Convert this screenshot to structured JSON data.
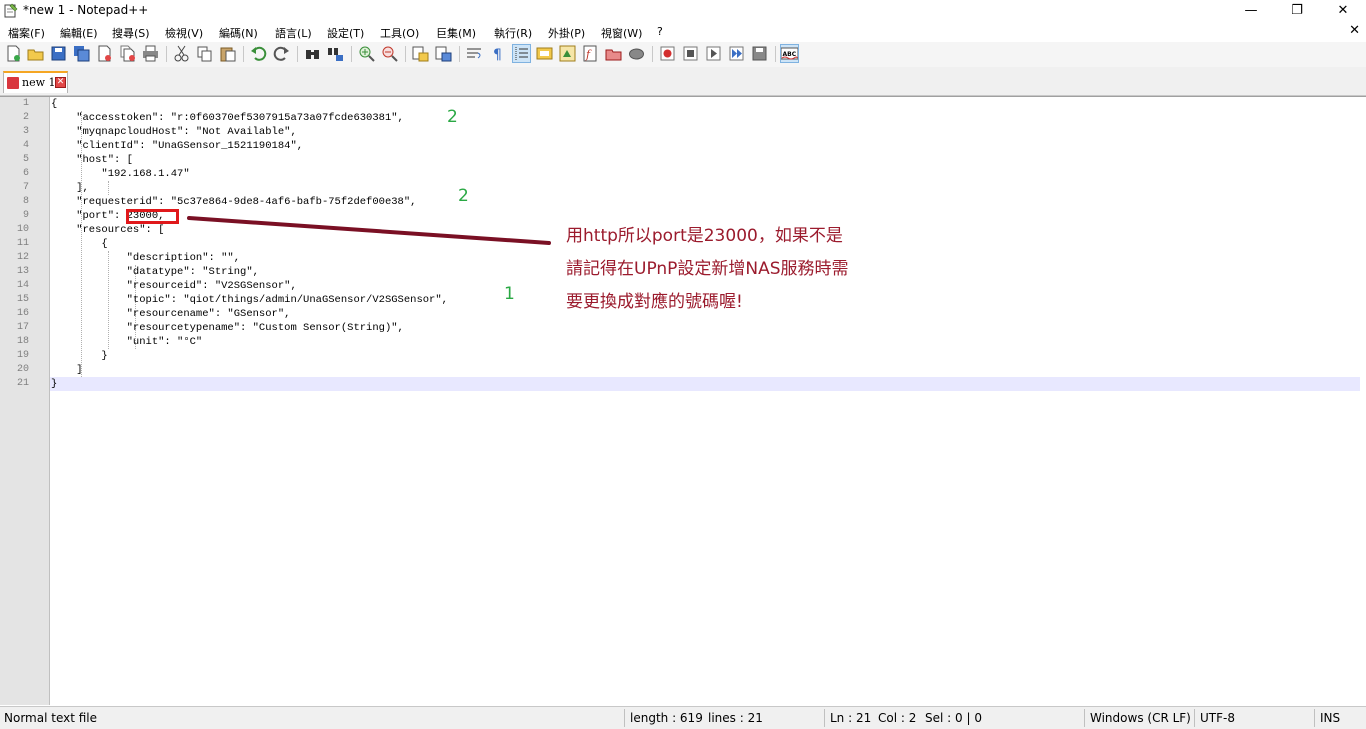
{
  "window": {
    "title": "*new 1 - Notepad++"
  },
  "menu": [
    "檔案(F)",
    "編輯(E)",
    "搜尋(S)",
    "檢視(V)",
    "編碼(N)",
    "語言(L)",
    "設定(T)",
    "工具(O)",
    "巨集(M)",
    "執行(R)",
    "外掛(P)",
    "視窗(W)",
    "?"
  ],
  "tab": {
    "label": "new 1",
    "close": "✕"
  },
  "lines": [
    {
      "n": "1",
      "t": "{"
    },
    {
      "n": "2",
      "t": "    \"accesstoken\": \"r:0f60370ef5307915a73a07fcde630381\","
    },
    {
      "n": "3",
      "t": "    \"myqnapcloudHost\": \"Not Available\","
    },
    {
      "n": "4",
      "t": "    \"clientId\": \"UnaGSensor_1521190184\","
    },
    {
      "n": "5",
      "t": "    \"host\": ["
    },
    {
      "n": "6",
      "t": "        \"192.168.1.47\""
    },
    {
      "n": "7",
      "t": "    ],"
    },
    {
      "n": "8",
      "t": "    \"requesterid\": \"5c37e864-9de8-4af6-bafb-75f2def00e38\","
    },
    {
      "n": "9",
      "t": "    \"port\": 23000,"
    },
    {
      "n": "10",
      "t": "    \"resources\": ["
    },
    {
      "n": "11",
      "t": "        {"
    },
    {
      "n": "12",
      "t": "            \"description\": \"\","
    },
    {
      "n": "13",
      "t": "            \"datatype\": \"String\","
    },
    {
      "n": "14",
      "t": "            \"resourceid\": \"V2SGSensor\","
    },
    {
      "n": "15",
      "t": "            \"topic\": \"qiot/things/admin/UnaGSensor/V2SGSensor\","
    },
    {
      "n": "16",
      "t": "            \"resourcename\": \"GSensor\","
    },
    {
      "n": "17",
      "t": "            \"resourcetypename\": \"Custom Sensor(String)\","
    },
    {
      "n": "18",
      "t": "            \"unit\": \"°C\""
    },
    {
      "n": "19",
      "t": "        }"
    },
    {
      "n": "20",
      "t": "    ]"
    },
    {
      "n": "21",
      "t": "}"
    }
  ],
  "annotations": {
    "mark_line2": "2",
    "mark_line8": "2",
    "mark_line15": "1"
  },
  "note_lines": [
    "用http所以port是23000，如果不是",
    "請記得在UPnP設定新增NAS服務時需",
    "要更換成對應的號碼喔!"
  ],
  "status": {
    "type": "Normal text file",
    "length": "length : 619",
    "lines": "lines : 21",
    "ln": "Ln : 21",
    "col": "Col : 2",
    "sel": "Sel : 0 | 0",
    "eol": "Windows (CR LF)",
    "encoding": "UTF-8",
    "mode": "INS"
  },
  "colors": {
    "note": "#9b1b2d",
    "annotation": "#2aa844",
    "highlight_box": "#e0181b",
    "arrow": "#7a1024"
  }
}
